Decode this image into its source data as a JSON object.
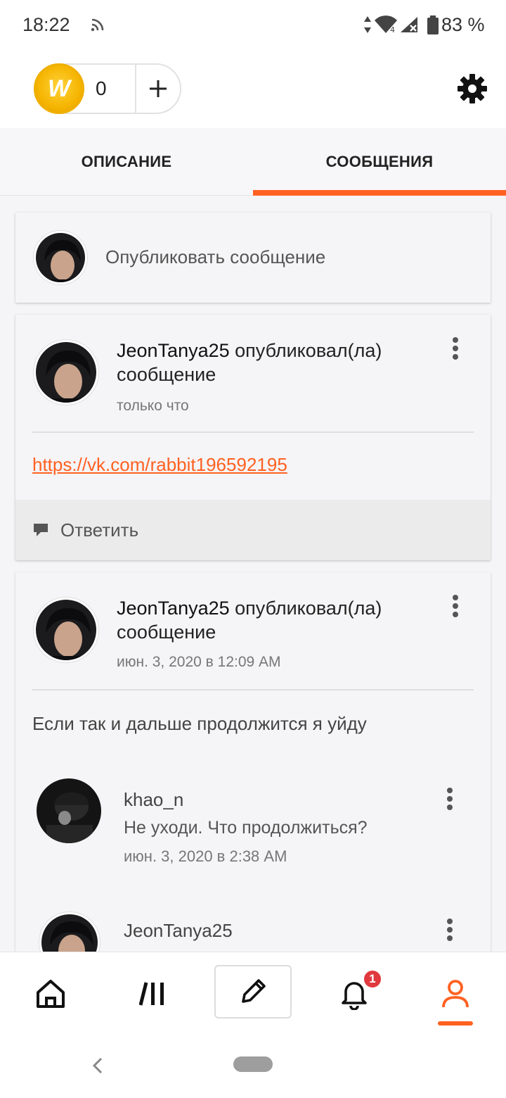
{
  "status_bar": {
    "time": "18:22",
    "battery": "83 %",
    "network_label": "4"
  },
  "header": {
    "coin_count": "0",
    "coin_symbol": "W"
  },
  "tabs": [
    {
      "label": "ОПИСАНИЕ",
      "active": false
    },
    {
      "label": "СООБЩЕНИЯ",
      "active": true
    }
  ],
  "composer": {
    "placeholder": "Опубликовать сообщение"
  },
  "posts": [
    {
      "author": "JeonTanya25",
      "action": "опубликовал(ла) сообщение",
      "time": "только что",
      "link": "https://vk.com/rabbit196592195",
      "reply_label": "Ответить"
    },
    {
      "author": "JeonTanya25",
      "action": "опубликовал(ла) сообщение",
      "time": "июн. 3, 2020 в 12:09 AM",
      "body": "Если так и дальше продолжится я уйду",
      "comments": [
        {
          "author": "khao_n",
          "text": "Не уходи. Что продолжиться?",
          "time": "июн. 3, 2020 в 2:38 AM"
        },
        {
          "author": "JeonTanya25"
        }
      ]
    }
  ],
  "bottom_nav": {
    "notification_count": "1",
    "active": "profile"
  },
  "colors": {
    "accent": "#ff6122",
    "badge": "#e0393e",
    "coin": "#f5b400"
  }
}
